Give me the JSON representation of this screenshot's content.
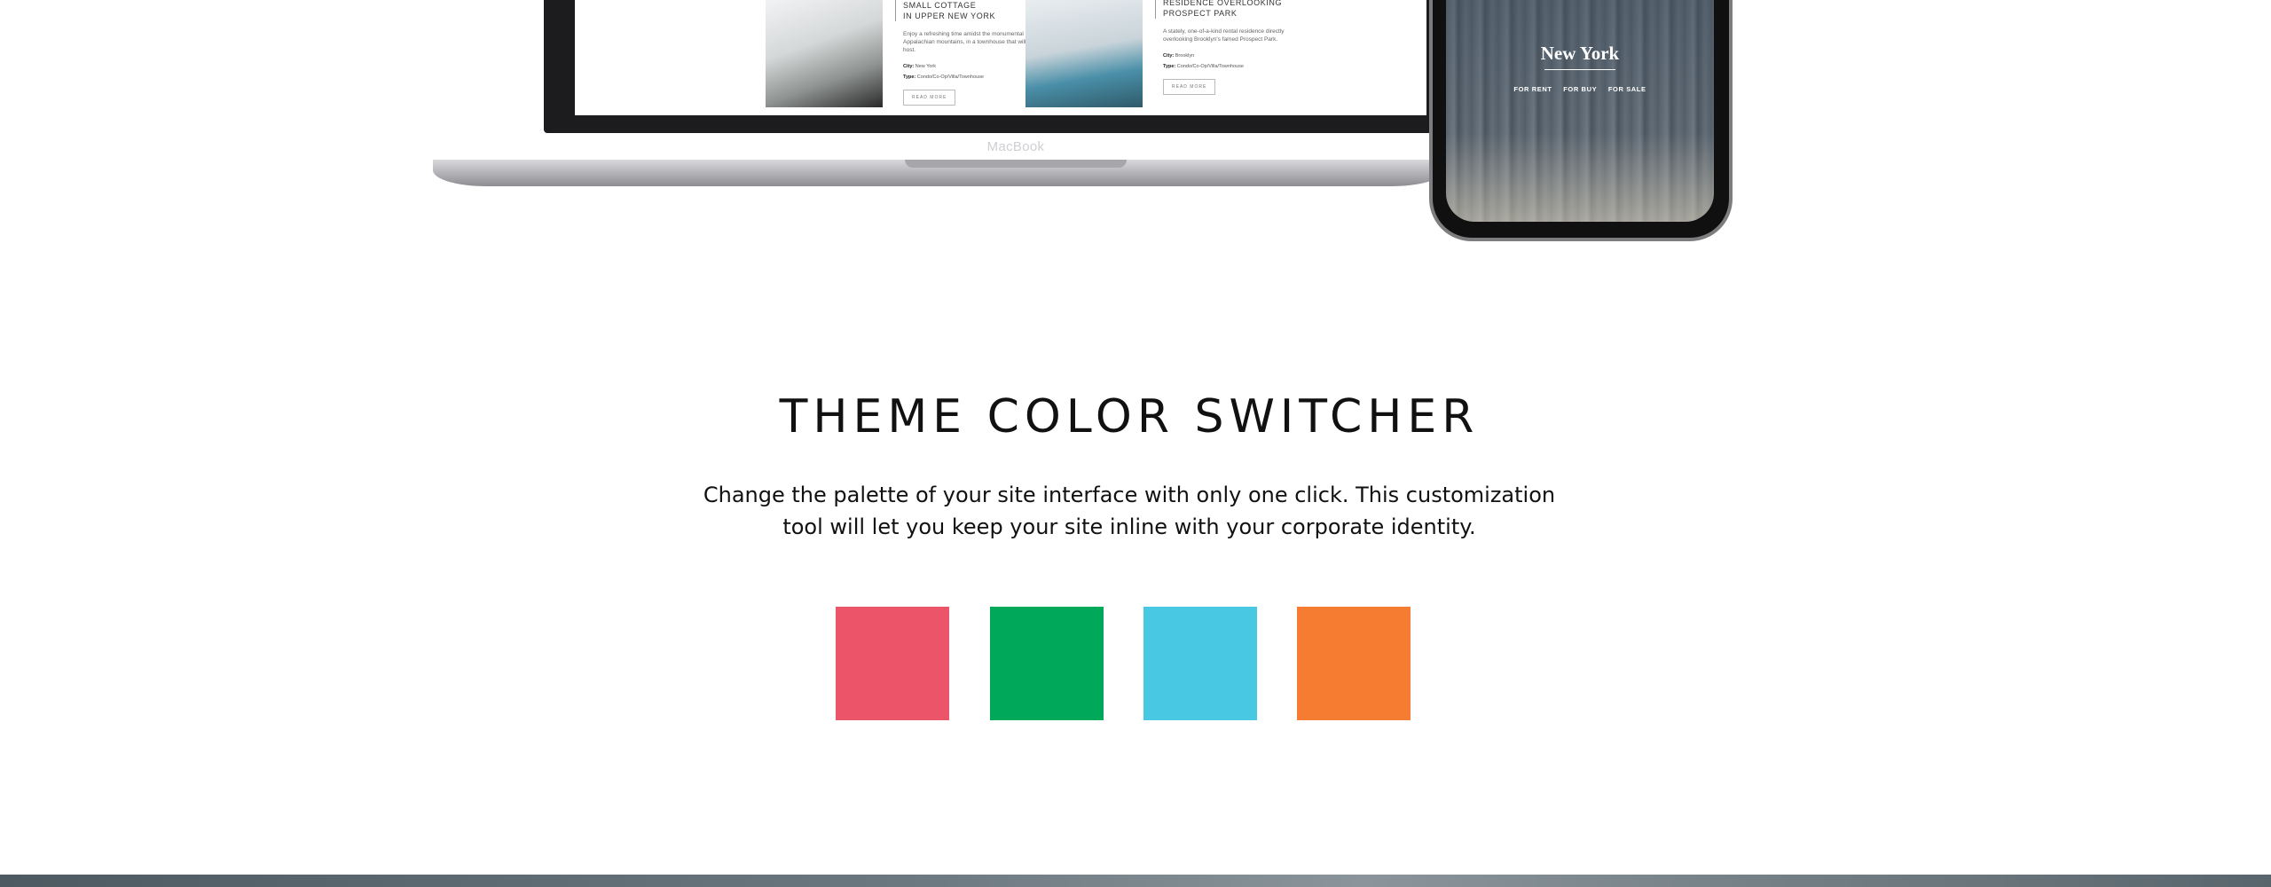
{
  "mockup": {
    "laptop_brand": "MacBook",
    "properties": [
      {
        "title_line1": "SMALL COTTAGE",
        "title_line2": "IN UPPER NEW YORK",
        "description": "Enjoy a refreshing time amidst the monumental Appalachian mountains, in a townhouse that will host.",
        "city_label": "City:",
        "city": "New York",
        "type_label": "Type:",
        "type": "Condo/Co-Op/Villa/Townhouse",
        "button": "READ MORE"
      },
      {
        "title_line1": "RESIDENCE OVERLOOKING",
        "title_line2": "PROSPECT PARK",
        "description": "A stately, one-of-a-kind rental residence directly overlooking Brooklyn's famed Prospect Park.",
        "city_label": "City:",
        "city": "Brooklyn",
        "type_label": "Type:",
        "type": "Condo/Co-Op/Villa/Townhouse",
        "button": "READ MORE"
      }
    ],
    "phone": {
      "city": "New York",
      "nav": [
        "FOR RENT",
        "FOR BUY",
        "FOR SALE"
      ]
    }
  },
  "section": {
    "title": "THEME COLOR SWITCHER",
    "description": "Change the palette of your site interface with only one click. This customization tool will let you keep your site inline with your corporate identity."
  },
  "swatches": [
    {
      "name": "pink",
      "color": "#ec5469"
    },
    {
      "name": "green",
      "color": "#00a859"
    },
    {
      "name": "blue",
      "color": "#48c8e2"
    },
    {
      "name": "orange",
      "color": "#f57c30"
    }
  ]
}
